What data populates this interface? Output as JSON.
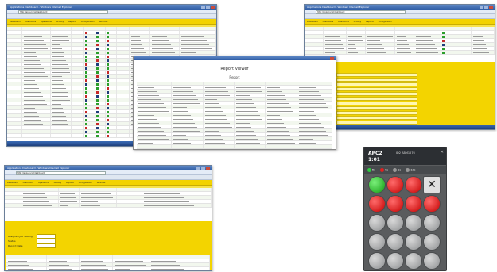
{
  "window1": {
    "title": "Applications Dashboard - Windows Internet Explorer",
    "address": "http://apps.local/dashboard",
    "menu": [
      "Dashboard",
      "Customers",
      "Operations",
      "Activity",
      "Reports",
      "Configuration",
      "Services",
      "Help"
    ],
    "row_count": 36
  },
  "window2": {
    "title": "Applications Dashboard - Windows Internet Explorer",
    "address": "http://apps.local/dashboard",
    "menu": [
      "Dashboard",
      "Customers",
      "Operations",
      "Activity",
      "Reports",
      "Configuration",
      "Services",
      "Help"
    ],
    "section_labels": [
      "General",
      "Assignment",
      "Notifications"
    ]
  },
  "popup": {
    "title": "Report Viewer",
    "subtitle": "Report"
  },
  "window3": {
    "title": "Applications Dashboard - Windows Internet Explorer",
    "address": "http://apps.local/dashboard",
    "menu": [
      "Dashboard",
      "Customers",
      "Operations",
      "Activity",
      "Reports",
      "Configuration",
      "Services",
      "Help"
    ],
    "form_labels": [
      "Assigned Job Setting",
      "Status",
      "Record Date"
    ]
  },
  "device": {
    "name": "APC2",
    "time": "1:01",
    "id_text": "ID2 ABM1276",
    "status": [
      {
        "label": "5s",
        "color": "#2ecc40"
      },
      {
        "label": "0s",
        "color": "#e02020"
      },
      {
        "label": "1s",
        "color": "#999999"
      },
      {
        "label": "13s",
        "color": "#999999"
      }
    ]
  },
  "colors": {
    "yellow": "#f2d200",
    "titlebar": "#2f5da6",
    "device_body": "#5a5c5e"
  }
}
